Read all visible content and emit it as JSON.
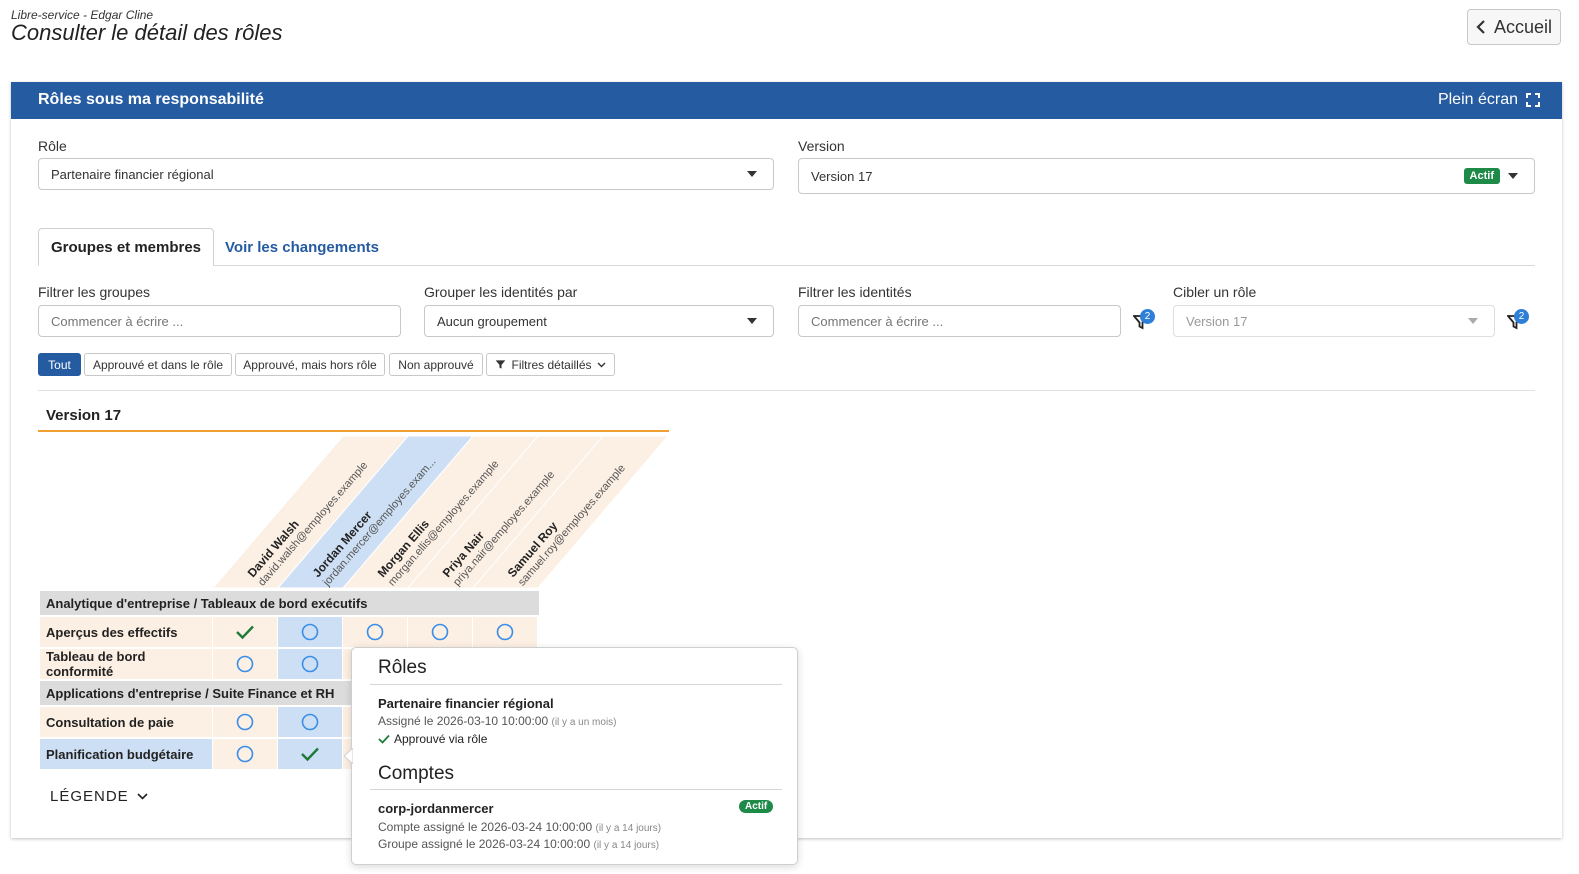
{
  "header": {
    "app_name": "Libre-service",
    "separator": " - ",
    "user_name": "Edgar Cline",
    "title": "Consulter le détail des rôles",
    "home_label": "Accueil"
  },
  "panel": {
    "title": "Rôles sous ma responsabilité",
    "fullscreen_label": "Plein écran"
  },
  "role_select": {
    "label": "Rôle",
    "value": "Partenaire financier régional"
  },
  "version_select": {
    "label": "Version",
    "value": "Version 17",
    "badge": "Actif"
  },
  "tabs": [
    {
      "label": "Groupes et membres",
      "active": true
    },
    {
      "label": "Voir les changements",
      "active": false
    }
  ],
  "filters": {
    "groups": {
      "label": "Filtrer les groupes",
      "placeholder": "Commencer à écrire ..."
    },
    "group_by": {
      "label": "Grouper les identités par",
      "value": "Aucun groupement"
    },
    "identities": {
      "label": "Filtrer les identités",
      "placeholder": "Commencer à écrire ...",
      "filter_count": "2"
    },
    "target_role": {
      "label": "Cibler un rôle",
      "value": "Version 17",
      "filter_count": "2"
    }
  },
  "pills": [
    "Tout",
    "Approuvé et dans le rôle",
    "Approuvé, mais hors rôle",
    "Non approuvé",
    "Filtres détaillés"
  ],
  "matrix": {
    "version_title": "Version 17",
    "columns": [
      {
        "name": "David Walsh",
        "email": "david.walsh@employes.example",
        "color": "peach"
      },
      {
        "name": "Jordan Mercer",
        "email": "jordan.mercer@employes.exam...",
        "color": "blue"
      },
      {
        "name": "Morgan Ellis",
        "email": "morgan.ellis@employes.example",
        "color": "peach"
      },
      {
        "name": "Priya Nair",
        "email": "priya.nair@employes.example",
        "color": "peach"
      },
      {
        "name": "Samuel Roy",
        "email": "samuel.roy@employes.example",
        "color": "peach"
      }
    ],
    "groups": [
      {
        "title": "Analytique d'entreprise / Tableaux de bord exécutifs",
        "rows": [
          {
            "label": "Aperçus des effectifs",
            "cells": [
              "check",
              "circle",
              "circle",
              "circle",
              "circle"
            ],
            "highlight": false
          },
          {
            "label": "Tableau de bord conformité",
            "cells": [
              "circle",
              "circle",
              "",
              "",
              ""
            ],
            "highlight": false
          }
        ]
      },
      {
        "title": "Applications d'entreprise / Suite Finance et RH",
        "rows": [
          {
            "label": "Consultation de paie",
            "cells": [
              "circle",
              "circle",
              "",
              "",
              ""
            ],
            "highlight": false
          },
          {
            "label": "Planification budgétaire",
            "cells": [
              "circle",
              "check",
              "",
              "",
              ""
            ],
            "highlight": true
          }
        ]
      }
    ],
    "legend_label": "LÉGENDE"
  },
  "popover": {
    "roles_heading": "Rôles",
    "role_name": "Partenaire financier régional",
    "role_assigned": "Assigné le 2026-03-10 10:00:00",
    "role_assigned_ago": "(il y a un mois)",
    "role_status": "Approuvé via rôle",
    "accounts_heading": "Comptes",
    "account_name": "corp-jordanmercer",
    "account_badge": "Actif",
    "account_assigned": "Compte assigné le 2026-03-24 10:00:00",
    "account_assigned_ago": "(il y a 14 jours)",
    "group_assigned": "Groupe assigné le 2026-03-24 10:00:00",
    "group_assigned_ago": "(il y a 14 jours)"
  },
  "colors": {
    "primary": "#255ba0",
    "accent_orange": "#f0a030",
    "success": "#1e8a47",
    "peach_cell": "#fcefe3",
    "blue_cell": "#cddff4",
    "circle": "#3a8ee6",
    "check": "#1f7a3a"
  }
}
